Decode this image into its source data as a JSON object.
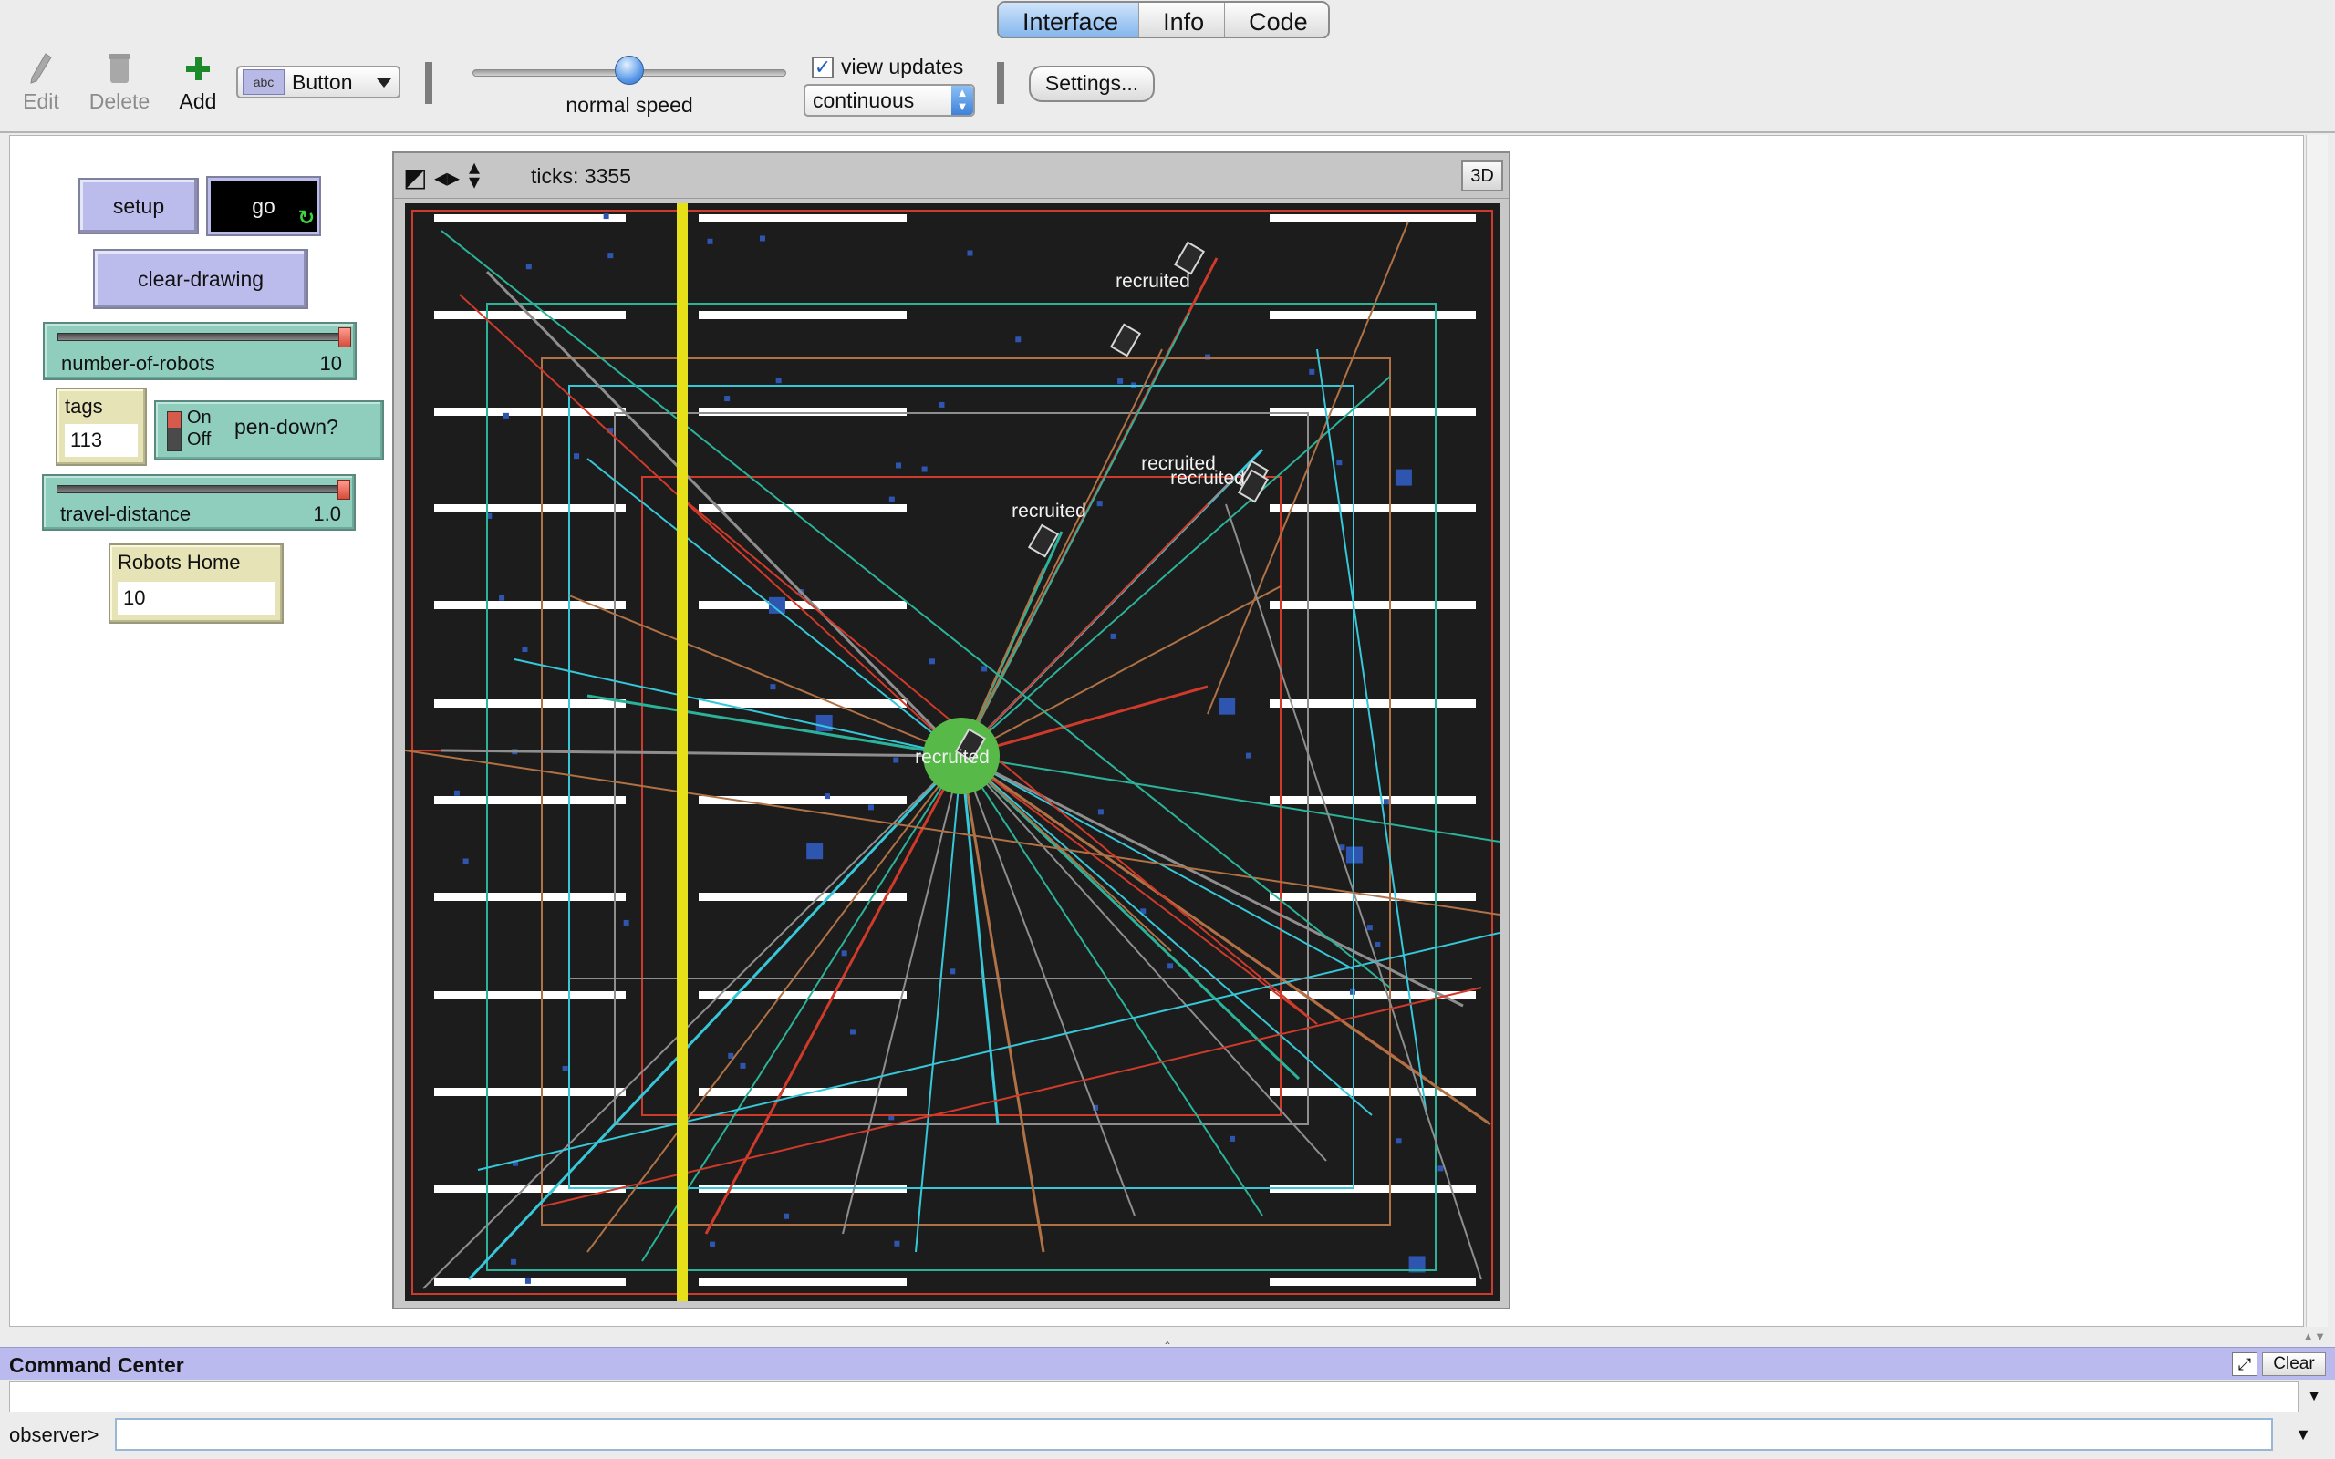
{
  "tabs": [
    {
      "label": "Interface",
      "active": true
    },
    {
      "label": "Info",
      "active": false
    },
    {
      "label": "Code",
      "active": false
    }
  ],
  "toolbar": {
    "edit_label": "Edit",
    "delete_label": "Delete",
    "add_label": "Add",
    "widget_type": "Button",
    "widget_type_icon_text": "abc",
    "speed_label": "normal speed",
    "speed_fraction": 0.5,
    "view_updates_label": "view updates",
    "view_updates_checked": true,
    "update_mode": "continuous",
    "settings_label": "Settings..."
  },
  "widgets": {
    "setup_label": "setup",
    "go_label": "go",
    "clear_drawing_label": "clear-drawing",
    "number_of_robots": {
      "name": "number-of-robots",
      "value": "10",
      "fraction": 1.0
    },
    "tags": {
      "name": "tags",
      "value": "113"
    },
    "pen_down": {
      "name": "pen-down?",
      "on_label": "On",
      "off_label": "Off"
    },
    "travel_distance": {
      "name": "travel-distance",
      "value": "1.0",
      "fraction": 1.0
    },
    "robots_home": {
      "name": "Robots Home",
      "value": "10"
    }
  },
  "view": {
    "ticks_label": "ticks: 3355",
    "btn_3d": "3D",
    "robot_label": "recruited",
    "colors": {
      "background": "#1c1c1c",
      "shelf": "#ffffff",
      "yellow_line": "#e5e01a",
      "home": "#56b948",
      "tag": "#2e56b0",
      "trail_red": "#d03a2a",
      "trail_teal": "#2bb39a",
      "trail_brown": "#b07245",
      "trail_cyan": "#36c7d8",
      "trail_gray": "#8e8e8e"
    }
  },
  "command_center": {
    "title": "Command Center",
    "clear_label": "Clear",
    "prompt": "observer>"
  }
}
